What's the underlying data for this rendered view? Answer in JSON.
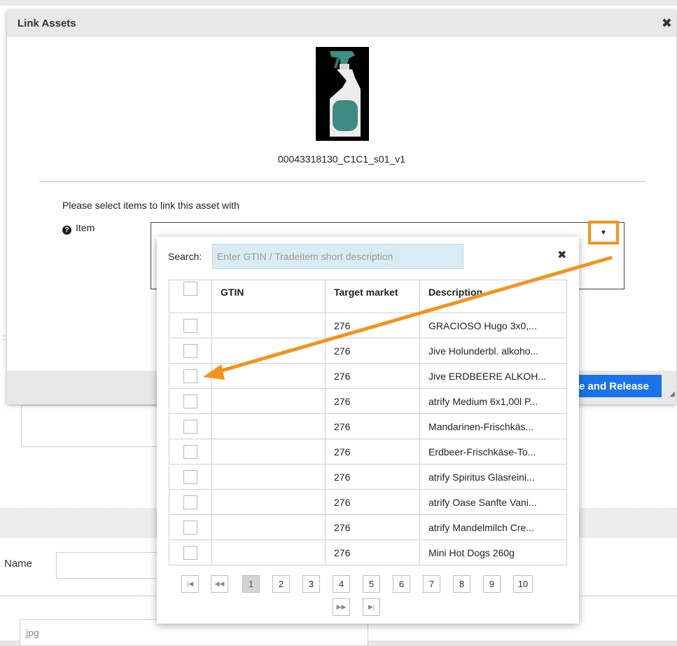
{
  "modal": {
    "title": "Link Assets",
    "close_glyph": "✖",
    "asset_name": "00043318130_C1C1_s01_v1",
    "instruction": "Please select items to link this asset with",
    "item_label": "Item",
    "help_glyph": "?",
    "dropdown_glyph": "▼",
    "release_button": "e and Release"
  },
  "search": {
    "label": "Search:",
    "placeholder": "Enter GTIN / Tradeitem short description",
    "clear_glyph": "✖"
  },
  "table": {
    "headers": {
      "gtin": "GTIN",
      "target_market": "Target market",
      "description": "Description"
    },
    "rows": [
      {
        "gtin": "",
        "target_market": "276",
        "description": "GRACIOSO Hugo 3x0,..."
      },
      {
        "gtin": "",
        "target_market": "276",
        "description": "Jive Holunderbl. alkoho..."
      },
      {
        "gtin": "",
        "target_market": "276",
        "description": "Jive ERDBEERE ALKOH..."
      },
      {
        "gtin": "",
        "target_market": "276",
        "description": "atrify Medium 6x1,00l P..."
      },
      {
        "gtin": "",
        "target_market": "276",
        "description": "Mandarinen-Frischkäs..."
      },
      {
        "gtin": "",
        "target_market": "276",
        "description": "Erdbeer-Frischkäse-To..."
      },
      {
        "gtin": "",
        "target_market": "276",
        "description": "atrify Spiritus Glasreini..."
      },
      {
        "gtin": "",
        "target_market": "276",
        "description": "atrify Oase Sanfte Vani..."
      },
      {
        "gtin": "",
        "target_market": "276",
        "description": "atrify Mandelmilch Cre..."
      },
      {
        "gtin": "",
        "target_market": "276",
        "description": "Mini Hot Dogs 260g"
      }
    ]
  },
  "pagination": {
    "first": "|◀",
    "prev": "◀◀",
    "pages": [
      "1",
      "2",
      "3",
      "4",
      "5",
      "6",
      "7",
      "8",
      "9",
      "10"
    ],
    "current_page": "1",
    "next": "▶▶",
    "last": "▶|"
  },
  "background": {
    "name_label": "Name",
    "file_type": "jpg"
  },
  "colors": {
    "highlight": "#f5921e",
    "primary_button": "#1a73e8",
    "search_bg": "#d9ecf5",
    "header_bg": "#e8e8e8"
  }
}
